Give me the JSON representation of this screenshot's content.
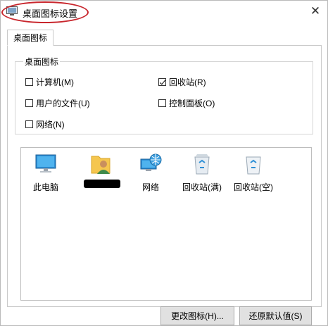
{
  "window": {
    "title": "桌面图标设置",
    "close_glyph": "✕",
    "icon": "desktop-settings-icon",
    "highlight_color": "#c8262d"
  },
  "tabs": [
    {
      "label": "桌面图标",
      "selected": true
    }
  ],
  "group": {
    "label": "桌面图标",
    "checkboxes": [
      {
        "label": "计算机(M)",
        "checked": false
      },
      {
        "label": "回收站(R)",
        "checked": true
      },
      {
        "label": "用户的文件(U)",
        "checked": false
      },
      {
        "label": "控制面板(O)",
        "checked": false
      },
      {
        "label": "网络(N)",
        "checked": false
      }
    ]
  },
  "icons": [
    {
      "label": "此电脑",
      "icon": "computer-icon"
    },
    {
      "label": "",
      "icon": "user-folder-icon",
      "redacted": true
    },
    {
      "label": "网络",
      "icon": "network-icon"
    },
    {
      "label": "回收站(满)",
      "icon": "recycle-bin-full-icon"
    },
    {
      "label": "回收站(空)",
      "icon": "recycle-bin-empty-icon"
    }
  ],
  "buttons": {
    "change_icon": "更改图标(H)...",
    "restore_default": "还原默认值(S)"
  }
}
